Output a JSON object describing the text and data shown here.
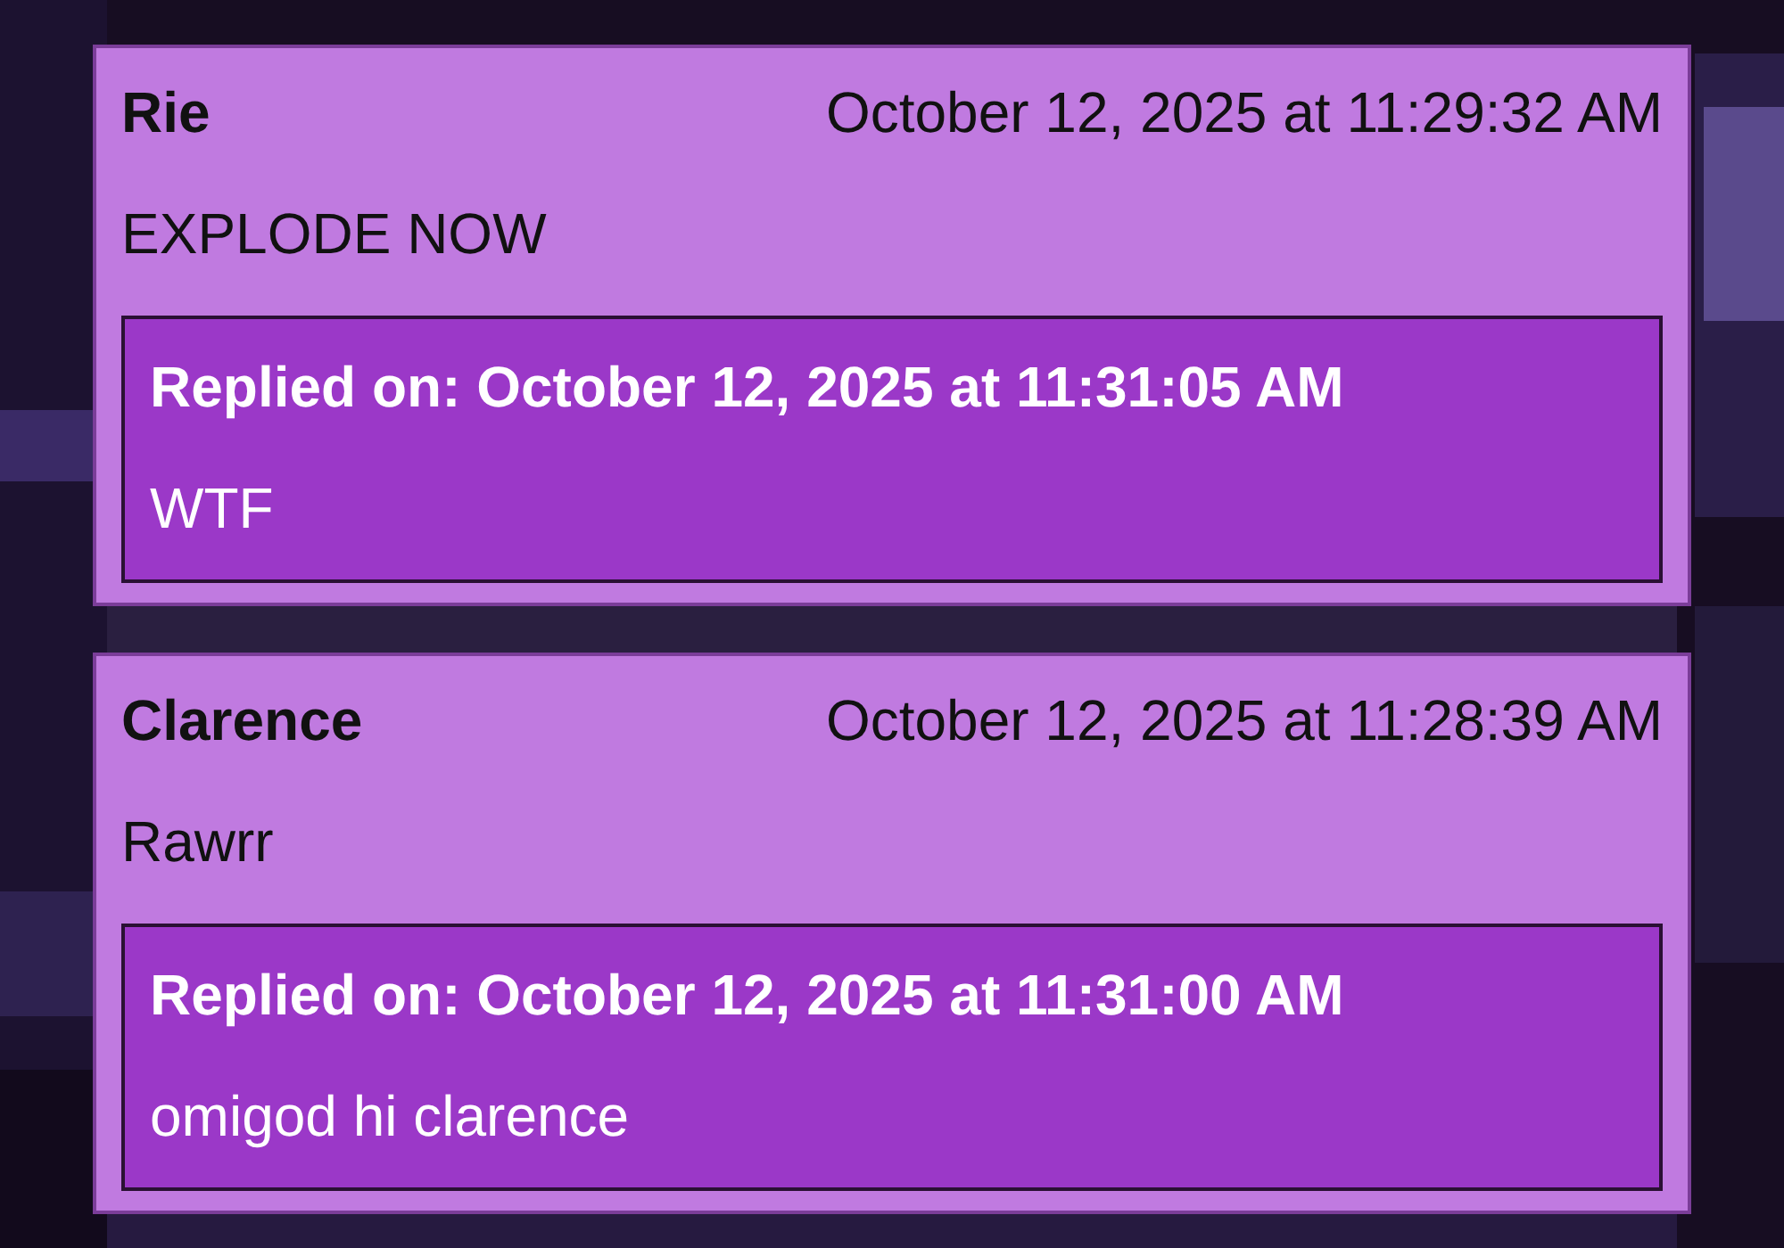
{
  "comments": [
    {
      "author": "Rie",
      "timestamp": "October 12, 2025 at 11:29:32 AM",
      "text": "EXPLODE NOW",
      "reply": {
        "heading": "Replied on: October 12, 2025 at 11:31:05 AM",
        "text": "WTF"
      }
    },
    {
      "author": "Clarence",
      "timestamp": "October 12, 2025 at 11:28:39 AM",
      "text": "Rawrr",
      "reply": {
        "heading": "Replied on: October 12, 2025 at 11:31:00 AM",
        "text": "omigod hi clarence"
      }
    }
  ]
}
